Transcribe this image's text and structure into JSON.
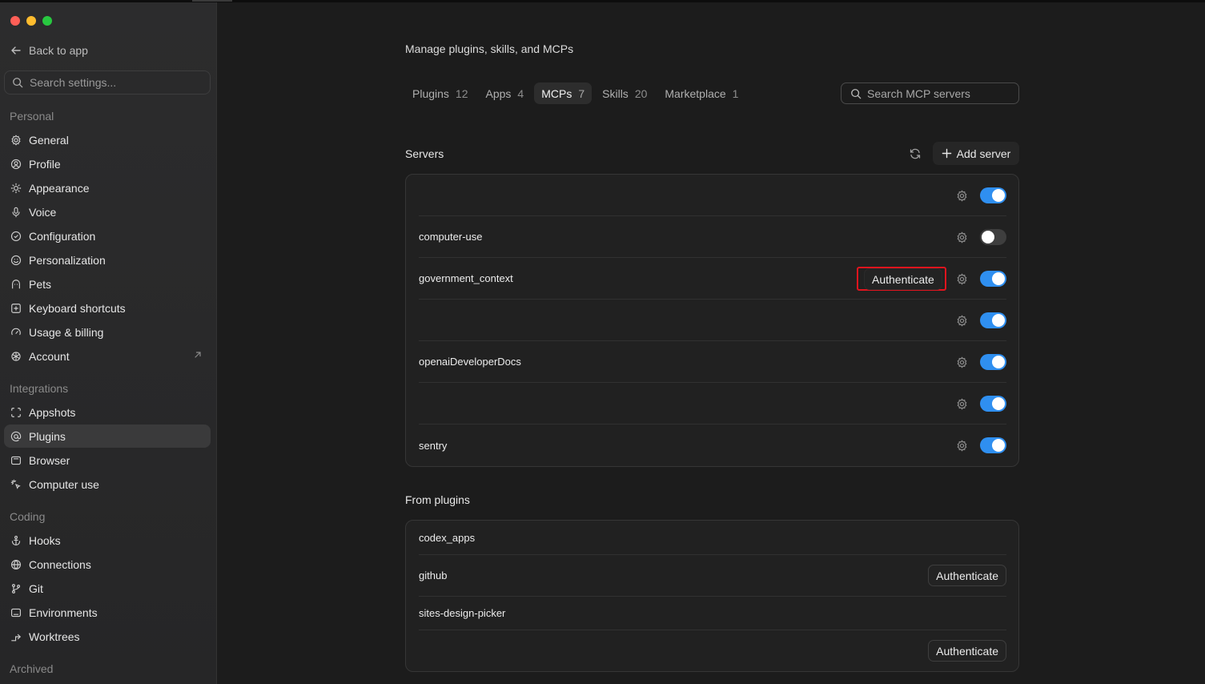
{
  "sidebar": {
    "back_label": "Back to app",
    "search_placeholder": "Search settings...",
    "sections": {
      "personal": "Personal",
      "integrations": "Integrations",
      "coding": "Coding",
      "archived": "Archived"
    },
    "personal_items": [
      {
        "label": "General",
        "icon": "gear-icon"
      },
      {
        "label": "Profile",
        "icon": "user-circle-icon"
      },
      {
        "label": "Appearance",
        "icon": "sun-icon"
      },
      {
        "label": "Voice",
        "icon": "microphone-icon"
      },
      {
        "label": "Configuration",
        "icon": "shield-icon"
      },
      {
        "label": "Personalization",
        "icon": "smile-icon"
      },
      {
        "label": "Pets",
        "icon": "pet-icon"
      },
      {
        "label": "Keyboard shortcuts",
        "icon": "keyboard-icon"
      },
      {
        "label": "Usage & billing",
        "icon": "gauge-icon"
      },
      {
        "label": "Account",
        "icon": "openai-icon"
      }
    ],
    "integration_items": [
      {
        "label": "Appshots",
        "icon": "screenshot-icon"
      },
      {
        "label": "Plugins",
        "icon": "at-icon"
      },
      {
        "label": "Browser",
        "icon": "browser-icon"
      },
      {
        "label": "Computer use",
        "icon": "sparkle-cursor-icon"
      }
    ],
    "coding_items": [
      {
        "label": "Hooks",
        "icon": "anchor-icon"
      },
      {
        "label": "Connections",
        "icon": "globe-icon"
      },
      {
        "label": "Git",
        "icon": "git-branch-icon"
      },
      {
        "label": "Environments",
        "icon": "environment-icon"
      },
      {
        "label": "Worktrees",
        "icon": "worktree-icon"
      }
    ],
    "active": "Plugins"
  },
  "main": {
    "title": "Manage plugins, skills, and MCPs",
    "tabs": [
      {
        "label": "Plugins",
        "count": "12"
      },
      {
        "label": "Apps",
        "count": "4"
      },
      {
        "label": "MCPs",
        "count": "7"
      },
      {
        "label": "Skills",
        "count": "20"
      },
      {
        "label": "Marketplace",
        "count": "1"
      }
    ],
    "active_tab": "MCPs",
    "search_placeholder": "Search MCP servers",
    "servers_heading": "Servers",
    "add_server_label": "Add server",
    "servers": [
      {
        "name": "",
        "enabled": true,
        "authenticate": false
      },
      {
        "name": "computer-use",
        "enabled": false,
        "authenticate": false
      },
      {
        "name": "government_context",
        "enabled": true,
        "authenticate": true
      },
      {
        "name": "",
        "enabled": true,
        "authenticate": false
      },
      {
        "name": "openaiDeveloperDocs",
        "enabled": true,
        "authenticate": false
      },
      {
        "name": "",
        "enabled": true,
        "authenticate": false
      },
      {
        "name": "sentry",
        "enabled": true,
        "authenticate": false
      }
    ],
    "authenticate_label": "Authenticate",
    "from_plugins_heading": "From plugins",
    "plugin_servers": [
      {
        "name": "codex_apps",
        "authenticate": false
      },
      {
        "name": "github",
        "authenticate": true
      },
      {
        "name": "sites-design-picker",
        "authenticate": false
      },
      {
        "name": "",
        "authenticate": true
      }
    ]
  },
  "colors": {
    "accent": "#2f8ff0",
    "highlight": "#e0141e",
    "background": "#1c1c1c",
    "sidebar": "#2a2a2b"
  }
}
